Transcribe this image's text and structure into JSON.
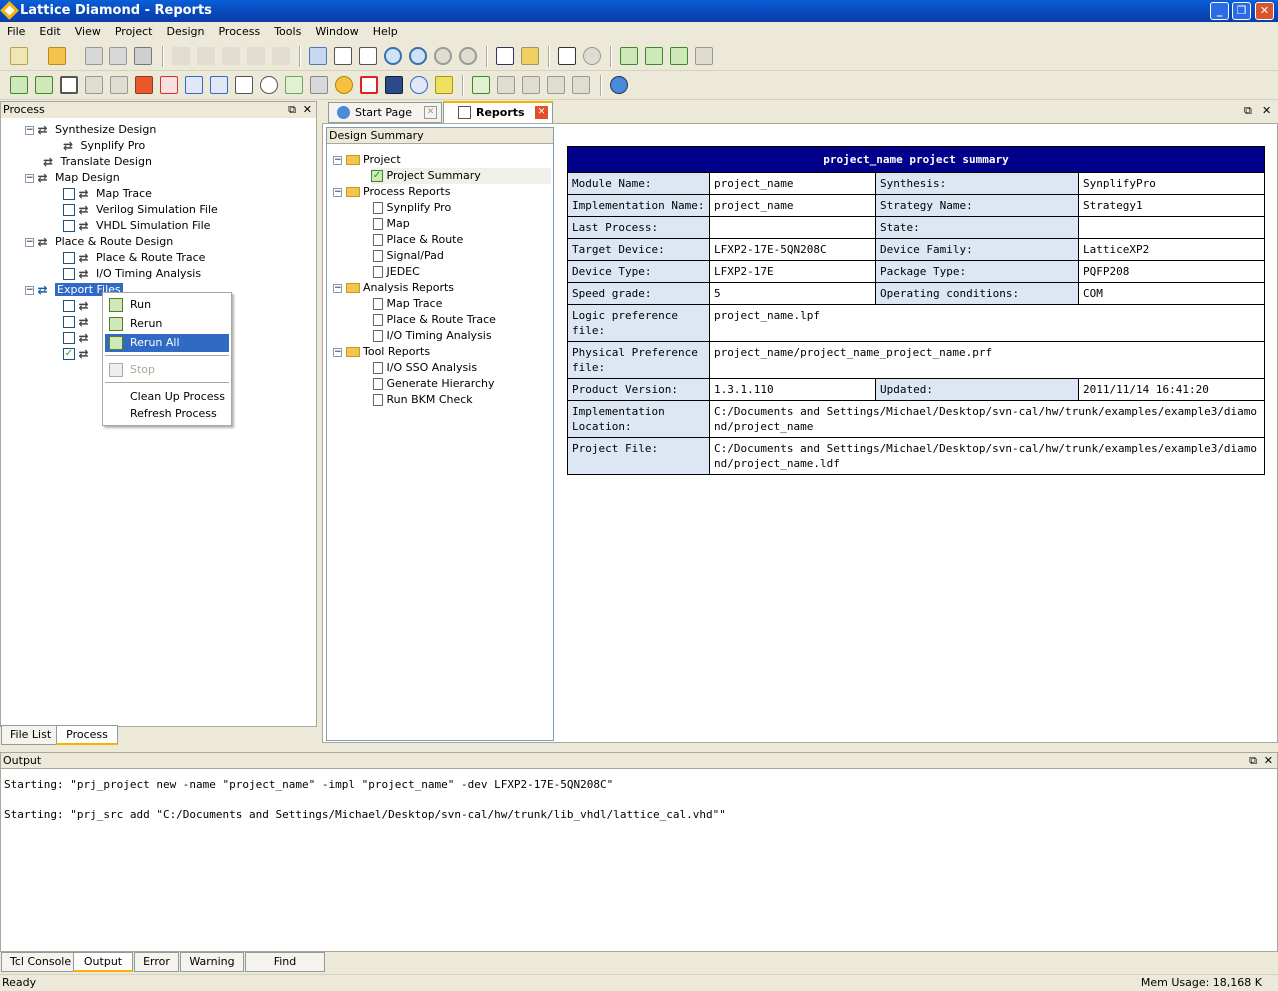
{
  "window": {
    "title": "Lattice Diamond - Reports",
    "minimize": "_",
    "restore": "❐",
    "close": "✕"
  },
  "menu": [
    "File",
    "Edit",
    "View",
    "Project",
    "Design",
    "Process",
    "Tools",
    "Window",
    "Help"
  ],
  "process_panel": {
    "title": "Process",
    "items": [
      {
        "label": "Synthesize Design"
      },
      {
        "label": "Synplify Pro"
      },
      {
        "label": "Translate Design"
      },
      {
        "label": "Map Design"
      },
      {
        "label": "Map Trace"
      },
      {
        "label": "Verilog Simulation File"
      },
      {
        "label": "VHDL Simulation File"
      },
      {
        "label": "Place & Route Design"
      },
      {
        "label": "Place & Route Trace"
      },
      {
        "label": "I/O Timing Analysis"
      },
      {
        "label": "Export Files"
      }
    ],
    "tabs": [
      "File List",
      "Process"
    ]
  },
  "context_menu": {
    "run": "Run",
    "rerun": "Rerun",
    "rerun_all": "Rerun All",
    "stop": "Stop",
    "cleanup": "Clean Up Process",
    "refresh": "Refresh Process"
  },
  "doc_tabs": {
    "start": "Start Page",
    "reports": "Reports"
  },
  "report_tree": {
    "header": "Design Summary",
    "project": "Project",
    "project_summary": "Project Summary",
    "process_reports": "Process Reports",
    "synplify": "Synplify Pro",
    "map": "Map",
    "par": "Place & Route",
    "signalpad": "Signal/Pad",
    "jedec": "JEDEC",
    "analysis_reports": "Analysis Reports",
    "map_trace": "Map Trace",
    "par_trace": "Place & Route Trace",
    "io_timing": "I/O Timing Analysis",
    "tool_reports": "Tool Reports",
    "io_sso": "I/O SSO Analysis",
    "gen_hier": "Generate Hierarchy",
    "bkm": "Run BKM Check"
  },
  "summary": {
    "title": "project_name project summary",
    "module_name_lbl": "Module Name:",
    "module_name": "project_name",
    "synthesis_lbl": "Synthesis:",
    "synthesis": "SynplifyPro",
    "impl_name_lbl": "Implementation Name:",
    "impl_name": "project_name",
    "strategy_lbl": "Strategy Name:",
    "strategy": "Strategy1",
    "last_process_lbl": "Last Process:",
    "last_process": "",
    "state_lbl": "State:",
    "state": "",
    "target_device_lbl": "Target Device:",
    "target_device": "LFXP2-17E-5QN208C",
    "device_family_lbl": "Device Family:",
    "device_family": "LatticeXP2",
    "device_type_lbl": "Device Type:",
    "device_type": "LFXP2-17E",
    "package_type_lbl": "Package Type:",
    "package_type": "PQFP208",
    "speed_lbl": "Speed grade:",
    "speed": "5",
    "op_cond_lbl": "Operating conditions:",
    "op_cond": "COM",
    "logic_pref_lbl": "Logic preference file:",
    "logic_pref": "project_name.lpf",
    "phys_pref_lbl": "Physical Preference file:",
    "phys_pref": "project_name/project_name_project_name.prf",
    "product_version_lbl": "Product Version:",
    "product_version": "1.3.1.110",
    "updated_lbl": "Updated:",
    "updated": "2011/11/14 16:41:20",
    "impl_loc_lbl": "Implementation Location:",
    "impl_loc": "C:/Documents and Settings/Michael/Desktop/svn-cal/hw/trunk/examples/example3/diamond/project_name",
    "project_file_lbl": "Project File:",
    "project_file": "C:/Documents and Settings/Michael/Desktop/svn-cal/hw/trunk/examples/example3/diamond/project_name.ldf"
  },
  "output": {
    "title": "Output",
    "line1": "Starting: \"prj_project new -name \"project_name\" -impl \"project_name\" -dev LFXP2-17E-5QN208C\"",
    "line2": "Starting: \"prj_src add \"C:/Documents and Settings/Michael/Desktop/svn-cal/hw/trunk/lib_vhdl/lattice_cal.vhd\"\"",
    "tabs": [
      "Tcl Console",
      "Output",
      "Error",
      "Warning",
      "Find Results"
    ]
  },
  "status": {
    "left": "Ready",
    "mem": "Mem Usage:  18,168 K"
  }
}
